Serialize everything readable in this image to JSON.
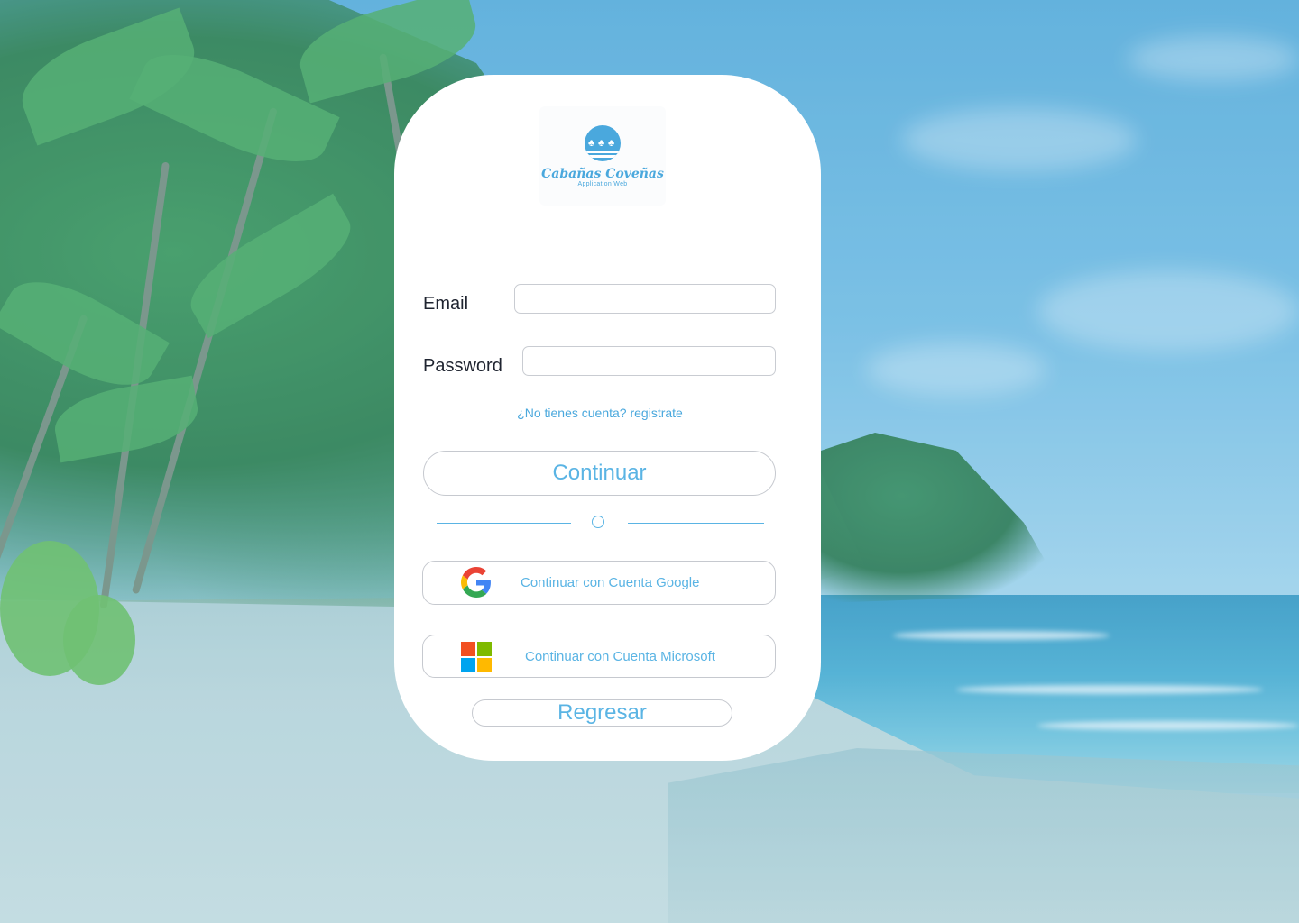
{
  "brand": {
    "name": "Cabañas Coveñas",
    "subtitle": "Application Web",
    "color": "#4aa8dd"
  },
  "form": {
    "email_label": "Email",
    "email_value": "",
    "password_label": "Password",
    "password_value": "",
    "register_link": "¿No tienes cuenta? registrate",
    "continue_label": "Continuar",
    "divider_icon": "circle-icon"
  },
  "social": {
    "google_label": "Continuar con Cuenta Google",
    "google_icon": "google-icon",
    "microsoft_label": "Continuar con Cuenta Microsoft",
    "microsoft_icon": "microsoft-icon"
  },
  "back_label": "Regresar",
  "colors": {
    "accent": "#5ab4e4",
    "card": "#ffffff",
    "text": "#1f2430"
  }
}
